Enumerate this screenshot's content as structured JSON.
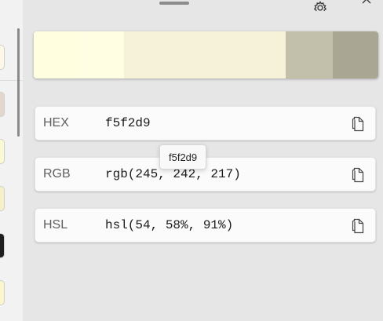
{
  "app": {
    "colors": {
      "background": "#e6e6e6",
      "history_panel": "#f2f2f2",
      "row_background": "#fbfbfb"
    }
  },
  "history": {
    "swatches": [
      {
        "color": "#fdf8e6"
      },
      {
        "color": "#e3d6cb"
      },
      {
        "color": "#fafad2"
      },
      {
        "color": "#f6f0c8"
      },
      {
        "color": "#1e1e1e"
      },
      {
        "color": "#fbf6cc"
      }
    ]
  },
  "toolbar": {
    "settings_icon": "gear-icon",
    "close_icon": "close-icon"
  },
  "gradient": {
    "segments": [
      {
        "color": "#ffffe0"
      },
      {
        "color": "#fffde2"
      },
      {
        "color": "#f5f2d9"
      },
      {
        "color": "#c2c0ab"
      },
      {
        "color": "#a9a794"
      }
    ]
  },
  "rows": {
    "hex": {
      "label": "HEX",
      "value": "f5f2d9"
    },
    "rgb": {
      "label": "RGB",
      "value": "rgb(245, 242, 217)"
    },
    "hsl": {
      "label": "HSL",
      "value": "hsl(54, 58%, 91%)"
    }
  },
  "tooltip": {
    "text": "f5f2d9"
  }
}
